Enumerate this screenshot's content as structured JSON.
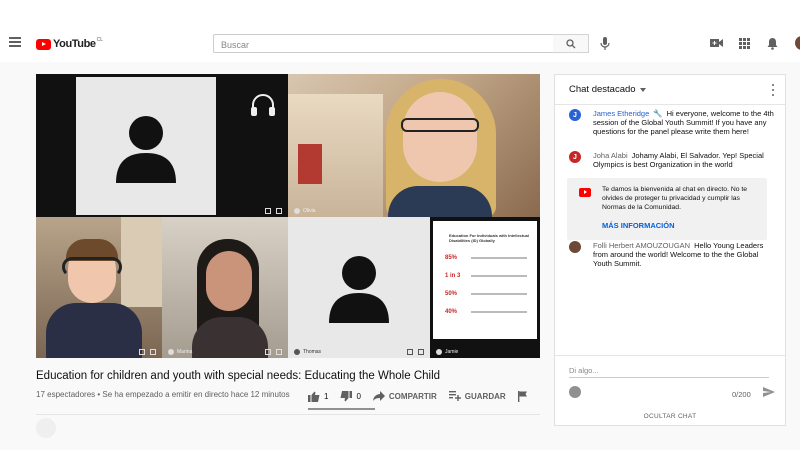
{
  "header": {
    "logo_text": "YouTube",
    "country_code": "CL",
    "search_placeholder": "Buscar"
  },
  "video": {
    "title": "Education for children and youth with special needs: Educating the Whole Child",
    "meta": "17 espectadores • Se ha empezado a emitir en directo hace 12 minutos",
    "likes": "1",
    "dislikes": "0",
    "share_label": "COMPARTIR",
    "save_label": "GUARDAR",
    "participants": [
      "Olivia",
      "Marina",
      "Thomas",
      "Jamie"
    ],
    "slide": {
      "title": "Education For Individuals with Intellectual Disabilities (ID) Globally",
      "stats": [
        "85%",
        "1 in 3",
        "50%",
        "40%"
      ]
    }
  },
  "chat": {
    "header": "Chat destacado",
    "messages": [
      {
        "initial": "J",
        "color": "#2962d4",
        "author": "James Etheridge",
        "owner": true,
        "text": "Hi everyone, welcome to the 4th session of the Global Youth Summit! If you have any questions for the panel please write them here!"
      },
      {
        "initial": "J",
        "color": "#c62828",
        "author": "Joha Alabi",
        "owner": false,
        "text": "Johamy Alabi, El Salvador. Yep! Special Olympics is best Organization in the world"
      },
      {
        "initial": "",
        "color": "#6d4a35",
        "author": "Folli Herbert AMOUZOUGAN",
        "owner": false,
        "text": "Hello Young Leaders from around the world! Welcome to the the Global Youth Summit."
      }
    ],
    "notice": {
      "text": "Te damos la bienvenida al chat en directo. No te olvides de proteger tu privacidad y cumplir las Normas de la Comunidad.",
      "more": "MÁS INFORMACIÓN"
    },
    "input_placeholder": "Di algo...",
    "counter": "0/200",
    "hide_label": "OCULTAR CHAT"
  }
}
